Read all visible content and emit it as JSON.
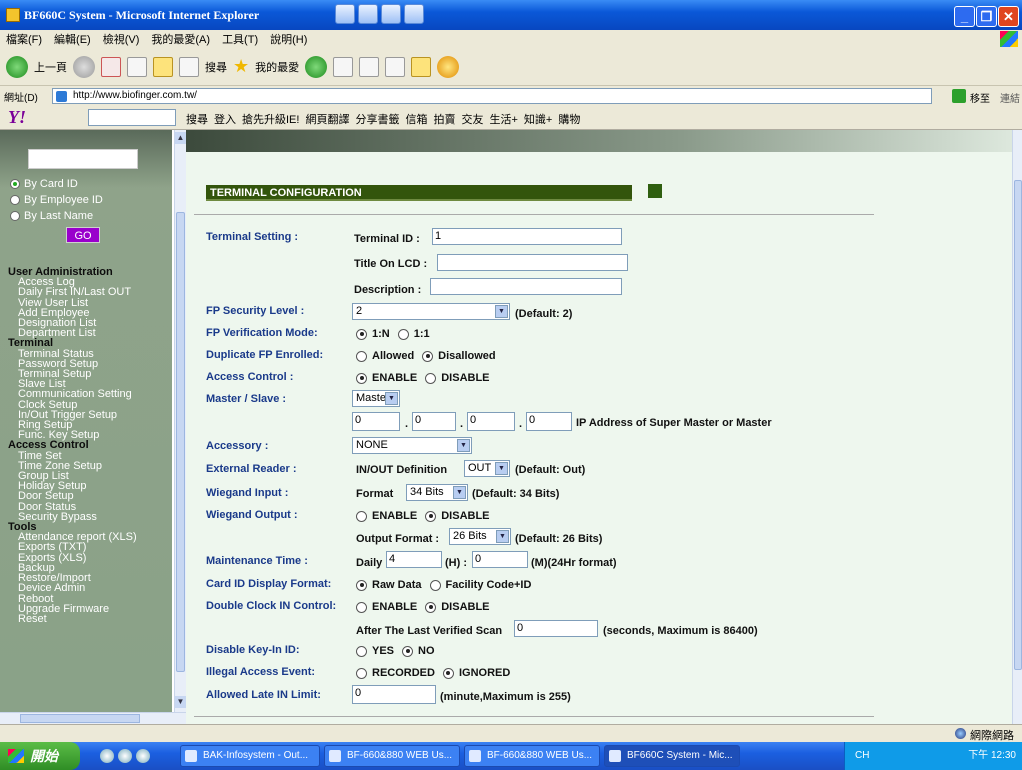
{
  "window": {
    "title": "BF660C System - Microsoft Internet Explorer"
  },
  "menu": [
    "檔案(F)",
    "編輯(E)",
    "檢視(V)",
    "我的最愛(A)",
    "工具(T)",
    "說明(H)"
  ],
  "toolbar": {
    "back": "上一頁",
    "search": "搜尋",
    "favorites": "我的最愛"
  },
  "address": {
    "label": "網址(D)",
    "url": "http://www.biofinger.com.tw/",
    "go": "移至",
    "links": "連結"
  },
  "yahoo_toolbar": {
    "logo": "Y!",
    "items": [
      "搜尋",
      "登入",
      "搶先升級IE!",
      "網頁翻譯",
      "分享書籤",
      "信箱",
      "拍賣",
      "交友",
      "生活+",
      "知識+",
      "購物"
    ]
  },
  "sidebar": {
    "search_value": "",
    "search_options": [
      {
        "label": "By Card ID",
        "selected": true
      },
      {
        "label": "By Employee ID",
        "selected": false
      },
      {
        "label": "By Last Name",
        "selected": false
      }
    ],
    "go_label": "GO",
    "nav": [
      {
        "type": "h",
        "label": "User Administration"
      },
      {
        "type": "i",
        "label": "Access Log"
      },
      {
        "type": "i",
        "label": "Daily First IN/Last OUT"
      },
      {
        "type": "i",
        "label": "View User List"
      },
      {
        "type": "i",
        "label": "Add Employee"
      },
      {
        "type": "i",
        "label": "Designation List"
      },
      {
        "type": "i",
        "label": "Department List"
      },
      {
        "type": "h",
        "label": "Terminal"
      },
      {
        "type": "i",
        "label": "Terminal Status"
      },
      {
        "type": "i",
        "label": "Password Setup"
      },
      {
        "type": "i",
        "label": "Terminal Setup"
      },
      {
        "type": "i",
        "label": "Slave List"
      },
      {
        "type": "i",
        "label": "Communication Setting"
      },
      {
        "type": "i",
        "label": "Clock Setup"
      },
      {
        "type": "i",
        "label": "In/Out Trigger Setup"
      },
      {
        "type": "i",
        "label": "Ring Setup"
      },
      {
        "type": "i",
        "label": "Func. Key Setup"
      },
      {
        "type": "h",
        "label": "Access Control"
      },
      {
        "type": "i",
        "label": "Time Set"
      },
      {
        "type": "i",
        "label": "Time Zone Setup"
      },
      {
        "type": "i",
        "label": "Group List"
      },
      {
        "type": "i",
        "label": "Holiday Setup"
      },
      {
        "type": "i",
        "label": "Door Setup"
      },
      {
        "type": "i",
        "label": "Door Status"
      },
      {
        "type": "i",
        "label": "Security Bypass"
      },
      {
        "type": "h",
        "label": "Tools"
      },
      {
        "type": "i",
        "label": "Attendance report (XLS)"
      },
      {
        "type": "i",
        "label": "Exports (TXT)"
      },
      {
        "type": "i",
        "label": "Exports (XLS)"
      },
      {
        "type": "i",
        "label": "Backup"
      },
      {
        "type": "i",
        "label": "Restore/Import"
      },
      {
        "type": "i",
        "label": "Device Admin"
      },
      {
        "type": "i",
        "label": "Reboot"
      },
      {
        "type": "i",
        "label": "Upgrade Firmware"
      },
      {
        "type": "i",
        "label": "Reset"
      }
    ]
  },
  "form": {
    "header": "TERMINAL CONFIGURATION",
    "terminal_setting_label": "Terminal Setting :",
    "terminal_id_label": "Terminal ID :",
    "terminal_id_value": "1",
    "title_lcd_label": "Title On LCD :",
    "title_lcd_value": "",
    "description_label": "Description :",
    "description_value": "",
    "fp_security_label": "FP Security Level :",
    "fp_security_value": "2",
    "fp_security_default": "(Default: 2)",
    "fp_verify_label": "FP Verification Mode:",
    "fp_verify_opt1": "1:N",
    "fp_verify_opt2": "1:1",
    "dup_fp_label": "Duplicate FP Enrolled:",
    "dup_fp_opt1": "Allowed",
    "dup_fp_opt2": "Disallowed",
    "access_control_label": "Access Control :",
    "access_control_opt1": "ENABLE",
    "access_control_opt2": "DISABLE",
    "master_slave_label": "Master / Slave :",
    "master_slave_value": "Master",
    "ip": [
      "0",
      "0",
      "0",
      "0"
    ],
    "ip_dot": ".",
    "ip_label": "IP Address of Super Master or Master",
    "accessory_label": "Accessory :",
    "accessory_value": "NONE",
    "ext_reader_label": "External Reader :",
    "ext_reader_def_label": "IN/OUT Definition",
    "ext_reader_value": "OUT",
    "ext_reader_default": "(Default: Out)",
    "wiegand_in_label": "Wiegand Input :",
    "wiegand_in_format_label": "Format",
    "wiegand_in_value": "34 Bits",
    "wiegand_in_default": "(Default: 34 Bits)",
    "wiegand_out_label": "Wiegand Output :",
    "wiegand_out_opt1": "ENABLE",
    "wiegand_out_opt2": "DISABLE",
    "wiegand_out_format_label": "Output Format :",
    "wiegand_out_value": "26 Bits",
    "wiegand_out_default": "(Default: 26 Bits)",
    "maint_label": "Maintenance Time :",
    "maint_daily": "Daily",
    "maint_h_value": "4",
    "maint_h_label": "(H) :",
    "maint_m_value": "0",
    "maint_m_label": "(M)(24Hr format)",
    "card_display_label": "Card ID Display Format:",
    "card_display_opt1": "Raw Data",
    "card_display_opt2": "Facility Code+ID",
    "double_clock_label": "Double Clock IN Control:",
    "double_clock_opt1": "ENABLE",
    "double_clock_opt2": "DISABLE",
    "after_scan_label": "After The Last Verified Scan",
    "after_scan_value": "0",
    "after_scan_hint": "(seconds, Maximum is 86400)",
    "disable_keyin_label": "Disable Key-In ID:",
    "disable_keyin_opt1": "YES",
    "disable_keyin_opt2": "NO",
    "illegal_label": "Illegal Access Event:",
    "illegal_opt1": "RECORDED",
    "illegal_opt2": "IGNORED",
    "late_label": "Allowed Late IN Limit:",
    "late_value": "0",
    "late_hint": "(minute,Maximum is 255)"
  },
  "statusbar": {
    "zone": "網際網路"
  },
  "taskbar": {
    "start": "開始",
    "tasks": [
      "BAK-Infosystem - Out...",
      "BF-660&880 WEB Us...",
      "BF-660&880 WEB Us...",
      "BF660C System - Mic..."
    ],
    "tray_lang": "CH",
    "clock": "下午 12:30"
  }
}
